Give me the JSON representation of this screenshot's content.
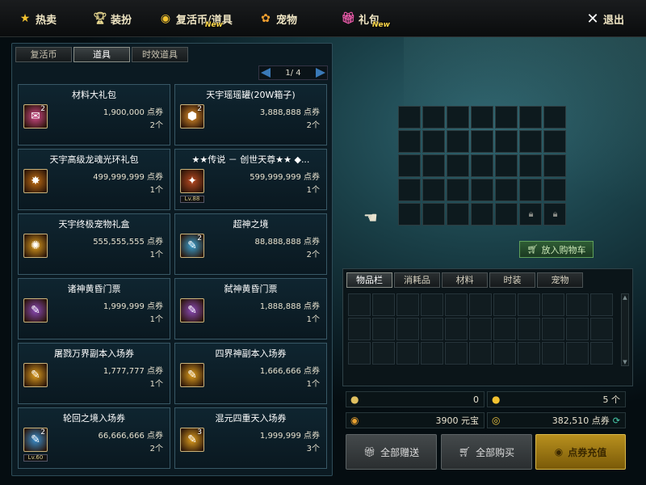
{
  "nav": {
    "items": [
      {
        "label": "热卖",
        "icon": "star-icon"
      },
      {
        "label": "装扮",
        "icon": "trophy-icon"
      },
      {
        "label": "复活币/道具",
        "icon": "coin-icon",
        "badge": "New"
      },
      {
        "label": "宠物",
        "icon": "paw-icon"
      },
      {
        "label": "礼包",
        "icon": "gift-icon",
        "badge": "New"
      }
    ],
    "exit": "退出"
  },
  "shop": {
    "tabs": [
      "复活币",
      "道具",
      "时效道具"
    ],
    "active_tab": "道具",
    "pager": "1/ 4",
    "items": [
      {
        "name": "材料大礼包",
        "price": "1,900,000",
        "unit": "点券",
        "qty": "2个",
        "count": "2",
        "level": "",
        "color": "#d24a8a"
      },
      {
        "name": "天宇瑶瑶罐(20W箱子)",
        "price": "3,888,888",
        "unit": "点券",
        "qty": "2个",
        "count": "2",
        "level": "",
        "color": "#e0902a"
      },
      {
        "name": "天宇高级龙魂光环礼包",
        "price": "499,999,999",
        "unit": "点券",
        "qty": "1个",
        "count": "",
        "level": "",
        "color": "#c47014"
      },
      {
        "name": "★★传说 － 创世天尊★★ ◆...",
        "price": "599,999,999",
        "unit": "点券",
        "qty": "1个",
        "count": "",
        "level": "Lv.88",
        "color": "#b84a22"
      },
      {
        "name": "天宇终极宠物礼盒",
        "price": "555,555,555",
        "unit": "点券",
        "qty": "1个",
        "count": "",
        "level": "",
        "color": "#e0a020"
      },
      {
        "name": "超神之境",
        "price": "88,888,888",
        "unit": "点券",
        "qty": "2个",
        "count": "2",
        "level": "",
        "color": "#3aa0d0"
      },
      {
        "name": "诸神黄昏门票",
        "price": "1,999,999",
        "unit": "点券",
        "qty": "1个",
        "count": "",
        "level": "",
        "color": "#8a4ab8"
      },
      {
        "name": "弑神黄昏门票",
        "price": "1,888,888",
        "unit": "点券",
        "qty": "1个",
        "count": "",
        "level": "",
        "color": "#8a4ab8"
      },
      {
        "name": "屠戮万界副本入场券",
        "price": "1,777,777",
        "unit": "点券",
        "qty": "1个",
        "count": "",
        "level": "",
        "color": "#e0a020"
      },
      {
        "name": "四界神副本入场券",
        "price": "1,666,666",
        "unit": "点券",
        "qty": "1个",
        "count": "",
        "level": "",
        "color": "#e0a020"
      },
      {
        "name": "轮回之境入场券",
        "price": "66,666,666",
        "unit": "点券",
        "qty": "2个",
        "count": "2",
        "level": "Lv.60",
        "color": "#3a90d0"
      },
      {
        "name": "混元四重天入场券",
        "price": "1,999,999",
        "unit": "点券",
        "qty": "3个",
        "count": "3",
        "level": "",
        "color": "#e0a020"
      }
    ]
  },
  "cart": {
    "button": "放入购物车"
  },
  "inventory": {
    "tabs": [
      "物品栏",
      "消耗品",
      "材料",
      "时装",
      "宠物"
    ],
    "active_tab": "物品栏"
  },
  "stats": {
    "a": "0",
    "b": "5 个",
    "yuanbao": "3900 元宝",
    "points": "382,510 点券"
  },
  "buttons": {
    "gift_all": "全部赠送",
    "buy_all": "全部购买",
    "recharge": "点券充值"
  }
}
